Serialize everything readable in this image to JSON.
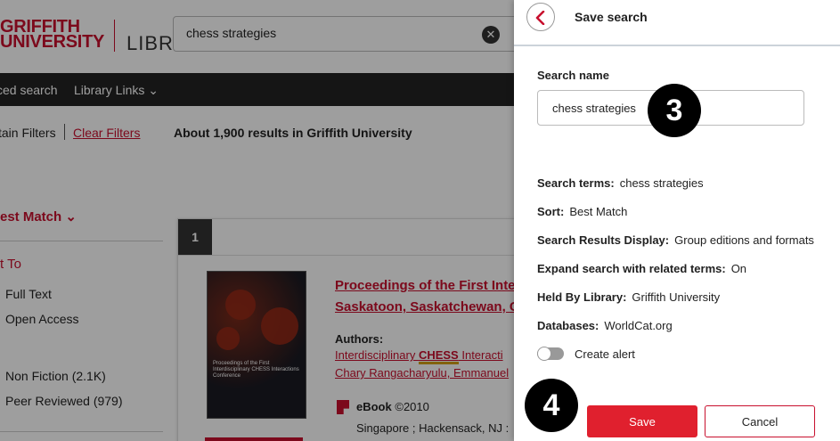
{
  "header": {
    "logo_line1": "GRIFFITH",
    "logo_line2": "UNIVERSITY",
    "logo_library": "LIBRA",
    "search_value": "chess strategies"
  },
  "nav": {
    "advanced_search": "ced search",
    "library_links": "Library Links"
  },
  "filters": {
    "retain": "tain Filters",
    "clear": "Clear Filters",
    "results_count": "About 1,900 results in Griffith University"
  },
  "sidebar": {
    "sort": "est Match",
    "limit_to": "t To",
    "items": [
      "Full Text",
      "Open Access",
      "Non Fiction (2.1K)",
      "Peer Reviewed (979)"
    ]
  },
  "result": {
    "number": "1",
    "title_line1": "Proceedings of the First Inte",
    "title_line2": "Saskatoon, Saskatchewan, C",
    "authors_label": "Authors:",
    "author_line1_pre": "Interdisciplinary ",
    "author_line1_hl": "CHESS",
    "author_line1_post": " Interacti",
    "author_line2": "Chary Rangacharyulu, Emmanuel",
    "format": "eBook",
    "year": "©2010",
    "publisher": "Singapore ; Hackensack, NJ :",
    "cover_title": "Proceedings of the First Interdisciplinary CHESS Interactions Conference"
  },
  "panel": {
    "title": "Save search",
    "search_name_label": "Search name",
    "search_name_value": "chess strategies",
    "rows": [
      {
        "label": "Search terms:",
        "value": "chess strategies"
      },
      {
        "label": "Sort:",
        "value": "Best Match"
      },
      {
        "label": "Search Results Display:",
        "value": "Group editions and formats"
      },
      {
        "label": "Expand search with related terms:",
        "value": "On"
      },
      {
        "label": "Held By Library:",
        "value": "Griffith University"
      },
      {
        "label": "Databases:",
        "value": "WorldCat.org"
      }
    ],
    "alert_label": "Create alert",
    "alert_on": false,
    "save_label": "Save",
    "cancel_label": "Cancel"
  },
  "badges": [
    "3",
    "4"
  ],
  "colors": {
    "brand_red": "#c8102e",
    "save_red": "#e0202e",
    "nav_dark": "#222222"
  }
}
